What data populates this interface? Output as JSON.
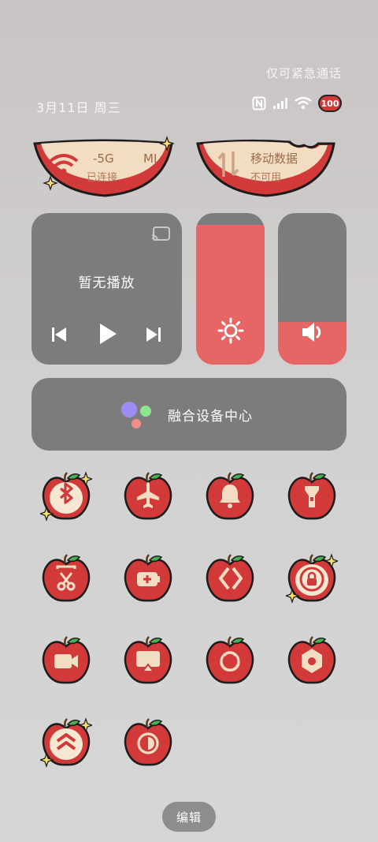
{
  "status_bar": {
    "emergency_text": "仅可紧急通话",
    "date": "3月11日 周三",
    "battery": "100"
  },
  "top_tiles": {
    "wifi": {
      "name": "-5G",
      "name_suffix": "MI",
      "status": "已连接",
      "icon": "wifi-icon"
    },
    "mobile_data": {
      "name": "移动数据",
      "status": "不可用",
      "icon": "mobile-data-icon"
    }
  },
  "media": {
    "title": "暂无播放"
  },
  "sliders": {
    "brightness_level": 0.92,
    "volume_level": 0.28
  },
  "devices": {
    "label": "融合设备中心"
  },
  "toggles": [
    {
      "icon": "bluetooth-icon",
      "active": false
    },
    {
      "icon": "airplane-icon",
      "active": true
    },
    {
      "icon": "bell-icon",
      "active": true
    },
    {
      "icon": "flashlight-icon",
      "active": true
    },
    {
      "icon": "screenshot-icon",
      "active": true
    },
    {
      "icon": "battery-saver-icon",
      "active": true
    },
    {
      "icon": "link-icon",
      "active": true
    },
    {
      "icon": "rotation-lock-icon",
      "active": false
    },
    {
      "icon": "screen-record-icon",
      "active": true
    },
    {
      "icon": "cast-icon",
      "active": true
    },
    {
      "icon": "hotspot-icon",
      "active": true
    },
    {
      "icon": "settings-icon",
      "active": true
    },
    {
      "icon": "chevrons-up-icon",
      "active": false
    },
    {
      "icon": "dark-mode-icon",
      "active": true
    }
  ],
  "edit_button": {
    "label": "编辑"
  },
  "colors": {
    "apple_red": "#d23a3a",
    "slider_fill": "#e66565",
    "tile_gray": "#7c7c7c",
    "cream": "#f2dcc2"
  }
}
